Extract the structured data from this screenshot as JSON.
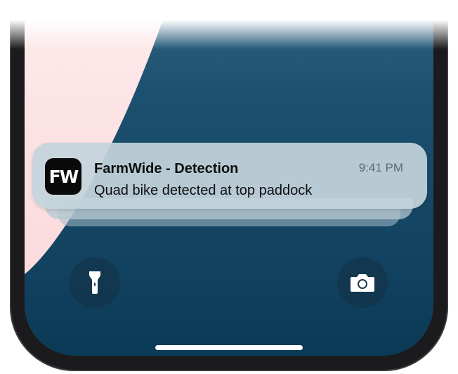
{
  "notification": {
    "app_icon_text": "FW",
    "title": "FarmWide - Detection",
    "time": "9:41 PM",
    "body": "Quad bike detected at top paddock"
  },
  "controls": {
    "flashlight_icon": "flashlight-icon",
    "camera_icon": "camera-icon"
  },
  "colors": {
    "wallpaper_pink": "#fde3e4",
    "wallpaper_blue_top": "#3b6f8c",
    "wallpaper_blue_bottom": "#0b3a56",
    "notification_bg": "#c4d4dc",
    "app_icon_bg": "#0a0a0a"
  }
}
